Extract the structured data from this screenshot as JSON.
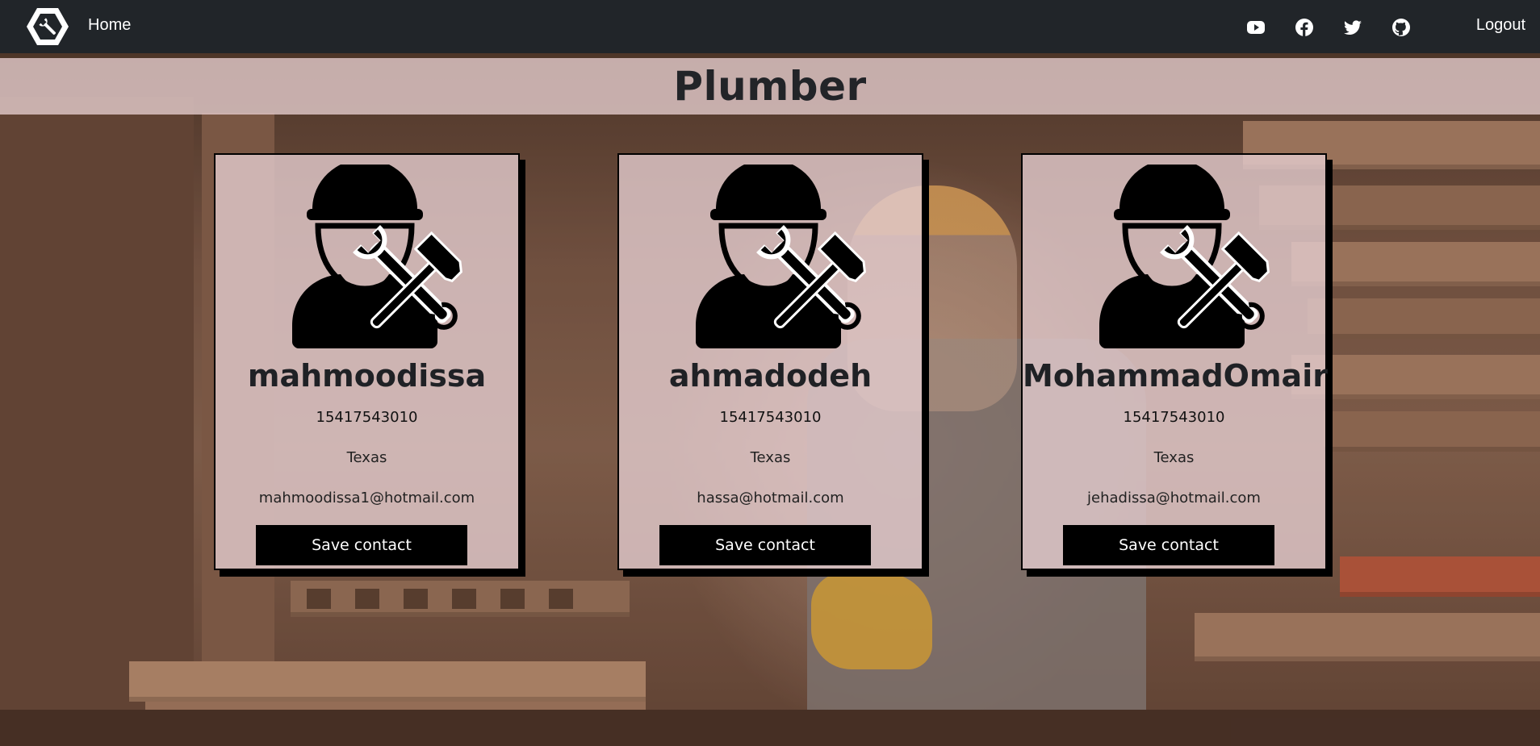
{
  "navbar": {
    "brand_icon": "wrench-hexagon-logo-icon",
    "home_label": "Home",
    "social_icons": [
      "youtube-icon",
      "facebook-icon",
      "twitter-icon",
      "github-icon"
    ],
    "logout_label": "Logout"
  },
  "page": {
    "title": "Plumber"
  },
  "workers": [
    {
      "name": "mahmoodissa",
      "phone": "15417543010",
      "state": "Texas",
      "email": "mahmoodissa1@hotmail.com",
      "button_label": "Save contact",
      "avatar_icon": "worker-with-tools-icon"
    },
    {
      "name": "ahmadodeh",
      "phone": "15417543010",
      "state": "Texas",
      "email": "hassa@hotmail.com",
      "button_label": "Save contact",
      "avatar_icon": "worker-with-tools-icon"
    },
    {
      "name": "MohammadOmair",
      "phone": "15417543010",
      "state": "Texas",
      "email": "jehadissa@hotmail.com",
      "button_label": "Save contact",
      "avatar_icon": "worker-with-tools-icon"
    }
  ],
  "colors": {
    "navbar_bg": "#212529",
    "card_bg": "#e4ccce",
    "button_bg": "#000000",
    "title_band_bg": "#e1c8c8"
  }
}
